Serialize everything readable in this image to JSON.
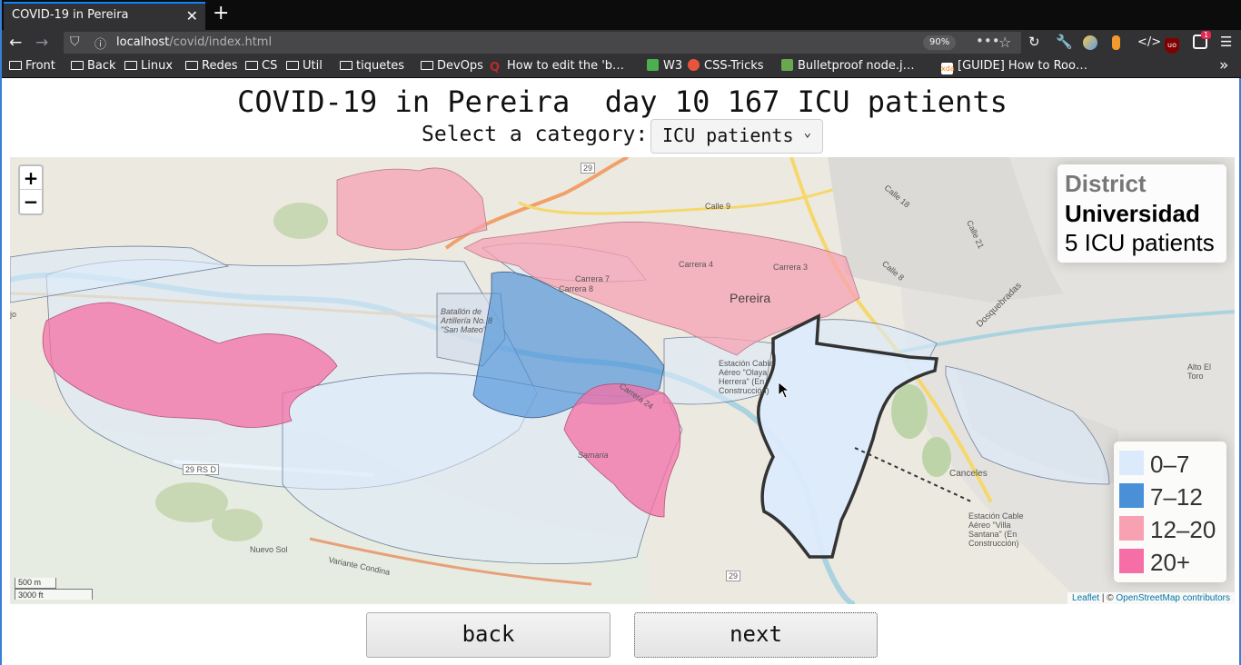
{
  "browser": {
    "tab_title": "COVID-19 in Pereira",
    "url_host": "localhost",
    "url_path": "/covid/index.html",
    "zoom": "90%",
    "notification_count": "1",
    "bookmarks": [
      {
        "label": "Front",
        "icon": "folder-icon"
      },
      {
        "label": "Back",
        "icon": "folder-icon"
      },
      {
        "label": "Linux",
        "icon": "folder-icon"
      },
      {
        "label": "Redes",
        "icon": "folder-icon"
      },
      {
        "label": "CS",
        "icon": "folder-icon"
      },
      {
        "label": "Util",
        "icon": "folder-icon"
      },
      {
        "label": "tiquetes",
        "icon": "folder-icon"
      },
      {
        "label": "DevOps",
        "icon": "folder-icon"
      },
      {
        "label": "How to edit the 'b…",
        "icon": "quora-icon"
      },
      {
        "label": "W3",
        "icon": "w3-icon"
      },
      {
        "label": "CSS-Tricks",
        "icon": "css-tricks-icon"
      },
      {
        "label": "Bulletproof node.j…",
        "icon": "node-icon"
      },
      {
        "label": "[GUIDE] How to Roo…",
        "icon": "xda-icon"
      }
    ]
  },
  "page": {
    "title": "COVID-19 in Pereira  day 10 167 ICU patients",
    "category_label": "Select a category:",
    "category_selected": "ICU patients"
  },
  "map": {
    "zoom_in": "+",
    "zoom_out": "−",
    "info": {
      "title": "District",
      "district": "Universidad",
      "value": "5 ICU patients"
    },
    "legend": [
      {
        "label": "0–7",
        "color": "#dcebfb"
      },
      {
        "label": "7–12",
        "color": "#4a90d9"
      },
      {
        "label": "12–20",
        "color": "#f7a1b3"
      },
      {
        "label": "20+",
        "color": "#f56fa6"
      }
    ],
    "scale": {
      "metric": "500 m",
      "imperial": "3000 ft"
    },
    "attribution": {
      "leaflet": "Leaflet",
      "separator": " | © ",
      "osm": "OpenStreetMap contributors"
    },
    "labels": {
      "city": "Pereira",
      "dosquebradas": "Dosquebradas",
      "alto_toro": "Alto El Toro",
      "canceles": "Canceles",
      "nuevo_sol": "Nuevo Sol",
      "samaria": "Samaria",
      "batallon": "Batallón de Artillería No. 8 \"San Mateo\"",
      "estacion_olaya": "Estación Cable Aéreo \"Olaya Herrera\" (En Construcción)",
      "estacion_villa": "Estación Cable Aéreo \"Villa Santana\" (En Construcción)",
      "variante": "Variante Condina",
      "road_29": "29",
      "road_29rsd": "29 RS D",
      "calle_9": "Calle 9",
      "calle_8": "Calle 8",
      "calle_18": "Calle 18",
      "calle_21": "Calle 21",
      "carrera_4": "Carrera 4",
      "carrera_3": "Carrera 3",
      "carrera_7": "Carrera 7",
      "carrera_8": "Carrera 8",
      "carrera_24": "Carrera 24",
      "jo": "jo"
    }
  },
  "buttons": {
    "back": "back",
    "next": "next"
  }
}
